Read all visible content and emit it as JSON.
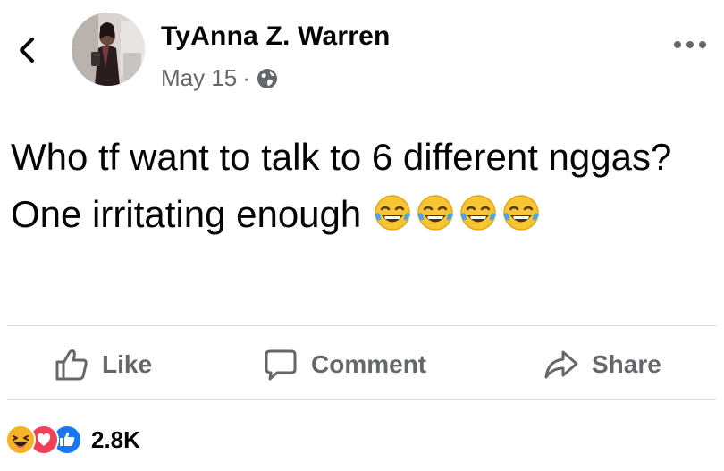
{
  "post": {
    "author": "TyAnna Z. Warren",
    "date": "May 15",
    "meta_separator": "·",
    "text": "Who tf want to talk to 6 different nggas? One irritating enough",
    "emoji": [
      "face-with-tears-of-joy",
      "face-with-tears-of-joy",
      "face-with-tears-of-joy",
      "face-with-tears-of-joy"
    ]
  },
  "actions": {
    "like_label": "Like",
    "comment_label": "Comment",
    "share_label": "Share"
  },
  "reactions": {
    "types": [
      "haha",
      "love",
      "like"
    ],
    "count": "2.8K"
  },
  "icons": {
    "back": "chevron-left-icon",
    "privacy": "globe-icon",
    "more": "more-dots-icon",
    "like": "thumbs-up-icon",
    "comment": "speech-bubble-icon",
    "share": "share-arrow-icon"
  },
  "colors": {
    "text_primary": "#050505",
    "text_secondary": "#65676b",
    "divider": "#dadde1",
    "like_blue": "#1877f2",
    "love_red": "#f33e58",
    "haha_yellow": "#f7b125"
  }
}
